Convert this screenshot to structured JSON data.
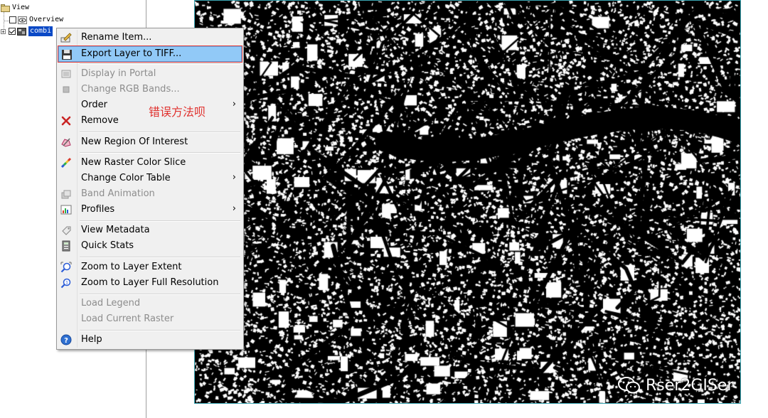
{
  "tree": {
    "root_label": "View",
    "items": [
      {
        "label": "Overview",
        "checked": false
      },
      {
        "label": "combi",
        "checked": true,
        "selected": true
      }
    ]
  },
  "context_menu": {
    "items": [
      {
        "id": "rename",
        "label": "Rename Item...",
        "icon": "rename-icon",
        "disabled": false,
        "submenu": false
      },
      {
        "id": "export",
        "label": "Export Layer to TIFF...",
        "icon": "save-icon",
        "disabled": false,
        "submenu": false,
        "highlighted": true
      },
      {
        "id": "display-portal",
        "label": "Display in Portal",
        "icon": "portal-icon",
        "disabled": true,
        "submenu": false
      },
      {
        "id": "change-rgb",
        "label": "Change RGB Bands...",
        "icon": "rgb-bands-icon",
        "disabled": true,
        "submenu": false
      },
      {
        "id": "order",
        "label": "Order",
        "icon": "",
        "disabled": false,
        "submenu": true
      },
      {
        "id": "remove",
        "label": "Remove",
        "icon": "remove-icon",
        "disabled": false,
        "submenu": false
      },
      {
        "id": "new-roi",
        "label": "New Region Of Interest",
        "icon": "roi-icon",
        "disabled": false,
        "submenu": false
      },
      {
        "id": "color-slice",
        "label": "New Raster Color Slice",
        "icon": "color-slice-icon",
        "disabled": false,
        "submenu": false
      },
      {
        "id": "color-table",
        "label": "Change Color Table",
        "icon": "",
        "disabled": false,
        "submenu": true
      },
      {
        "id": "band-animation",
        "label": "Band Animation",
        "icon": "animation-icon",
        "disabled": true,
        "submenu": false
      },
      {
        "id": "profiles",
        "label": "Profiles",
        "icon": "profiles-icon",
        "disabled": false,
        "submenu": true
      },
      {
        "id": "view-metadata",
        "label": "View Metadata",
        "icon": "metadata-icon",
        "disabled": false,
        "submenu": false
      },
      {
        "id": "quick-stats",
        "label": "Quick Stats",
        "icon": "stats-icon",
        "disabled": false,
        "submenu": false
      },
      {
        "id": "zoom-extent",
        "label": "Zoom to Layer Extent",
        "icon": "zoom-extent-icon",
        "disabled": false,
        "submenu": false
      },
      {
        "id": "zoom-full",
        "label": "Zoom to Layer Full Resolution",
        "icon": "zoom-full-icon",
        "disabled": false,
        "submenu": false
      },
      {
        "id": "load-legend",
        "label": "Load Legend",
        "icon": "",
        "disabled": true,
        "submenu": false
      },
      {
        "id": "load-raster",
        "label": "Load Current Raster",
        "icon": "",
        "disabled": true,
        "submenu": false
      },
      {
        "id": "help",
        "label": "Help",
        "icon": "help-icon",
        "disabled": false,
        "submenu": false
      }
    ],
    "submenu_arrow": "›"
  },
  "annotation": {
    "text": "错误方法呗",
    "color": "#e0322f"
  },
  "watermark": {
    "text": "Rser2GISer"
  },
  "colors": {
    "selection": "#0a49c6",
    "menu_highlight": "#91c9f7",
    "highlight_outline": "#e03c3c",
    "map_border": "#3aa6b3"
  }
}
